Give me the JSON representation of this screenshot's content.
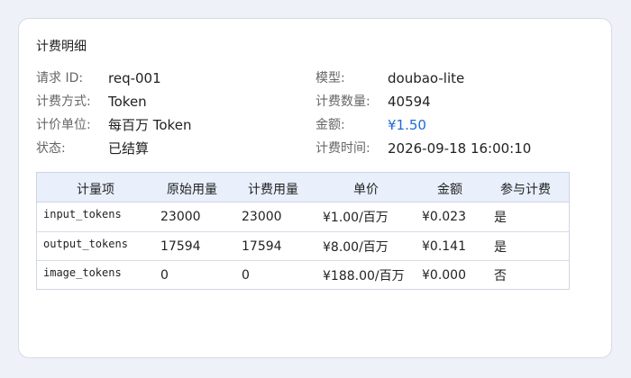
{
  "panel": {
    "title": "计费明细"
  },
  "info": {
    "rows": [
      [
        {
          "label": "请求 ID:",
          "value": "req-001"
        },
        {
          "label": "模型:",
          "value": "doubao-lite"
        }
      ],
      [
        {
          "label": "计费方式:",
          "value": "Token"
        },
        {
          "label": "计费数量:",
          "value": "40594"
        }
      ],
      [
        {
          "label": "计价单位:",
          "value": "每百万 Token"
        },
        {
          "label": "金额:",
          "value": "¥1.50"
        }
      ],
      [
        {
          "label": "状态:",
          "value": "已结算"
        },
        {
          "label": "计费时间:",
          "value": "2026-09-18 16:00:10"
        }
      ]
    ]
  },
  "table": {
    "headers": [
      "计量项",
      "原始用量",
      "计费用量",
      "单价",
      "金额",
      "参与计费"
    ],
    "rows": [
      [
        "input_tokens",
        "23000",
        "23000",
        "¥1.00/百万",
        "¥0.023",
        "是"
      ],
      [
        "output_tokens",
        "17594",
        "17594",
        "¥8.00/百万",
        "¥0.141",
        "是"
      ],
      [
        "image_tokens",
        "0",
        "0",
        "¥188.00/百万",
        "¥0.000",
        "否"
      ]
    ]
  },
  "colors": {
    "amount": "#1e6bd6",
    "table_header_bg": "#e9f0fc"
  }
}
